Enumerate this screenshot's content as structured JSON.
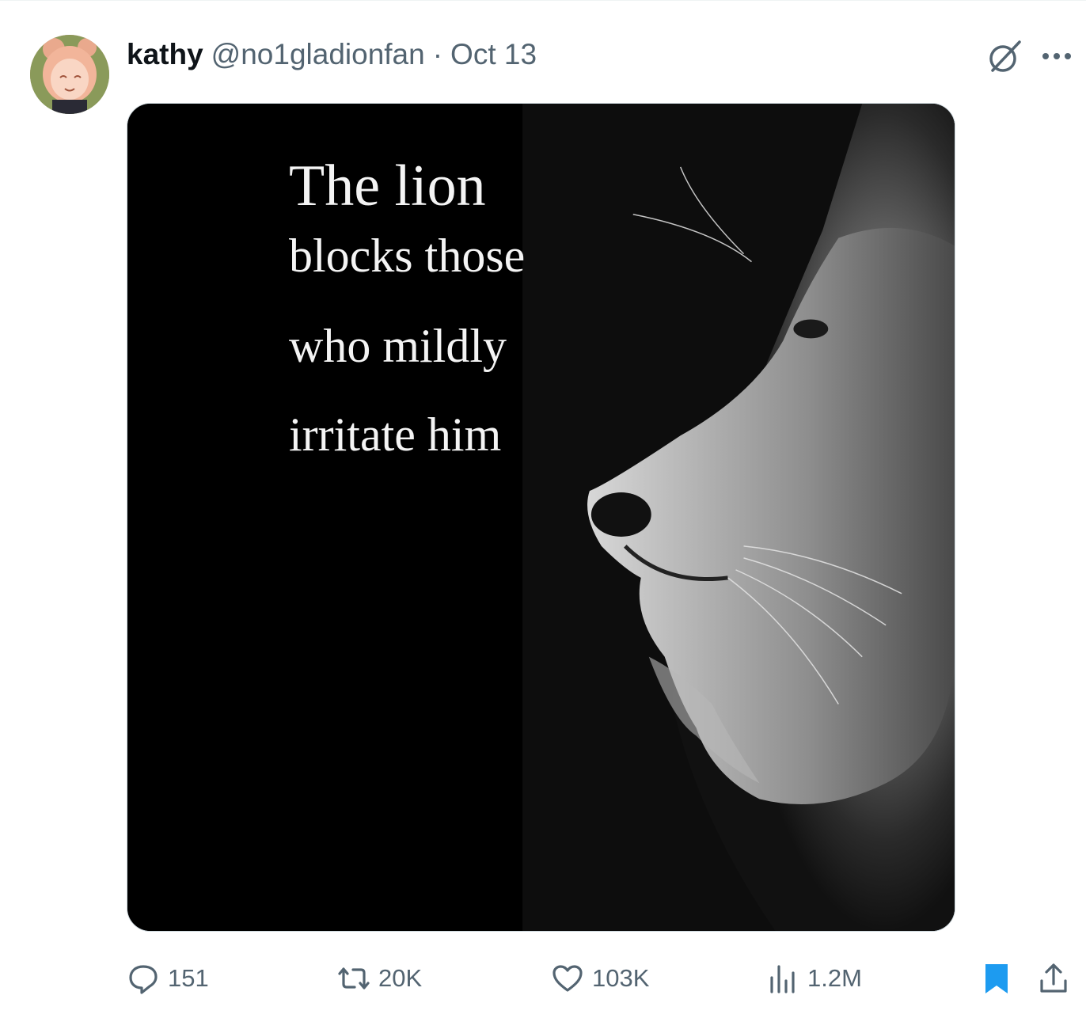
{
  "tweet": {
    "display_name": "kathy",
    "handle": "@no1gladionfan",
    "separator": "·",
    "date": "Oct 13",
    "icons": {
      "avatar": "profile-avatar",
      "grok": "grok-icon",
      "more": "more-icon"
    },
    "image": {
      "line1": "The lion",
      "line2": "blocks those",
      "line3": "who mildly",
      "line4": "irritate him",
      "subject": "lion profile"
    },
    "stats": {
      "replies": "151",
      "reposts": "20K",
      "likes": "103K",
      "views": "1.2M"
    },
    "colors": {
      "text_primary": "#0f1419",
      "text_secondary": "#536471",
      "bookmark_active": "#1d9bf0"
    }
  }
}
